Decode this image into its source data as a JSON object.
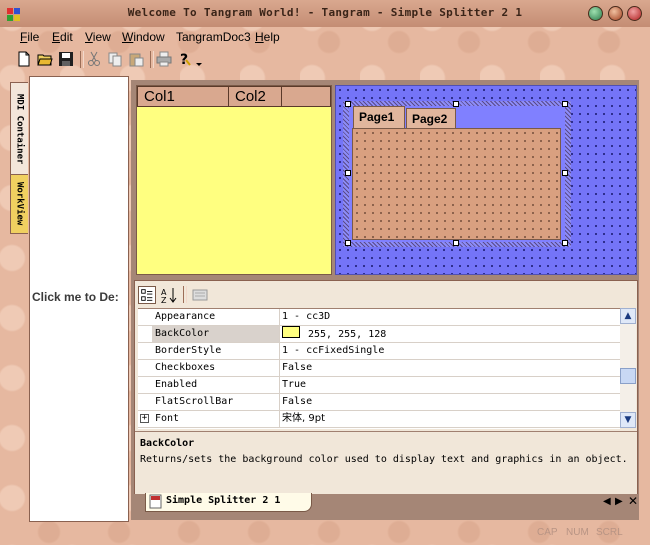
{
  "window": {
    "title": "Welcome To Tangram World! - Tangram - Simple Splitter 2 1"
  },
  "menu": {
    "items": [
      {
        "label": "File",
        "key": "F",
        "rest": "ile"
      },
      {
        "label": "Edit",
        "key": "E",
        "rest": "dit"
      },
      {
        "label": "View",
        "key": "V",
        "rest": "iew"
      },
      {
        "label": "Window",
        "key": "W",
        "rest": "indow"
      },
      {
        "label": "TangramDoc3",
        "key": "",
        "rest": "TangramDoc3"
      },
      {
        "label": "Help",
        "key": "H",
        "rest": "elp"
      }
    ]
  },
  "toolbar": {
    "icons": [
      "new-icon",
      "open-icon",
      "save-icon",
      "cut-icon",
      "copy-icon",
      "paste-icon",
      "print-icon",
      "help-icon"
    ]
  },
  "left_tabs": {
    "mdi": "MDI Container",
    "workview": "WorkView"
  },
  "side_panel": {
    "text": "Click me to De:"
  },
  "list": {
    "columns": [
      "Col1",
      "Col2",
      ""
    ],
    "backcolor": "#ffff80"
  },
  "design": {
    "tabs": [
      "Page1",
      "Page2"
    ]
  },
  "properties": {
    "rows": [
      {
        "name": "Appearance",
        "value": "1 - cc3D",
        "swatch": ""
      },
      {
        "name": "BackColor",
        "value": "255, 255, 128",
        "swatch": "#ffff80",
        "selected": true
      },
      {
        "name": "BorderStyle",
        "value": "1 - ccFixedSingle",
        "swatch": ""
      },
      {
        "name": "Checkboxes",
        "value": "False",
        "swatch": ""
      },
      {
        "name": "Enabled",
        "value": "True",
        "swatch": ""
      },
      {
        "name": "FlatScrollBar",
        "value": "False",
        "swatch": ""
      },
      {
        "name": "Font",
        "value": "宋体, 9pt",
        "swatch": "",
        "expandable": true
      }
    ],
    "description_title": "BackColor",
    "description_text": "Returns/sets the background color used to display text and graphics in an object."
  },
  "doc_tab": {
    "label": "Simple Splitter 2 1"
  },
  "status": {
    "cap": "CAP",
    "num": "NUM",
    "scrl": "SCRL"
  },
  "colors": {
    "accent": "#8080ff",
    "frame": "#e1b69d",
    "yellow": "#ffff80"
  }
}
